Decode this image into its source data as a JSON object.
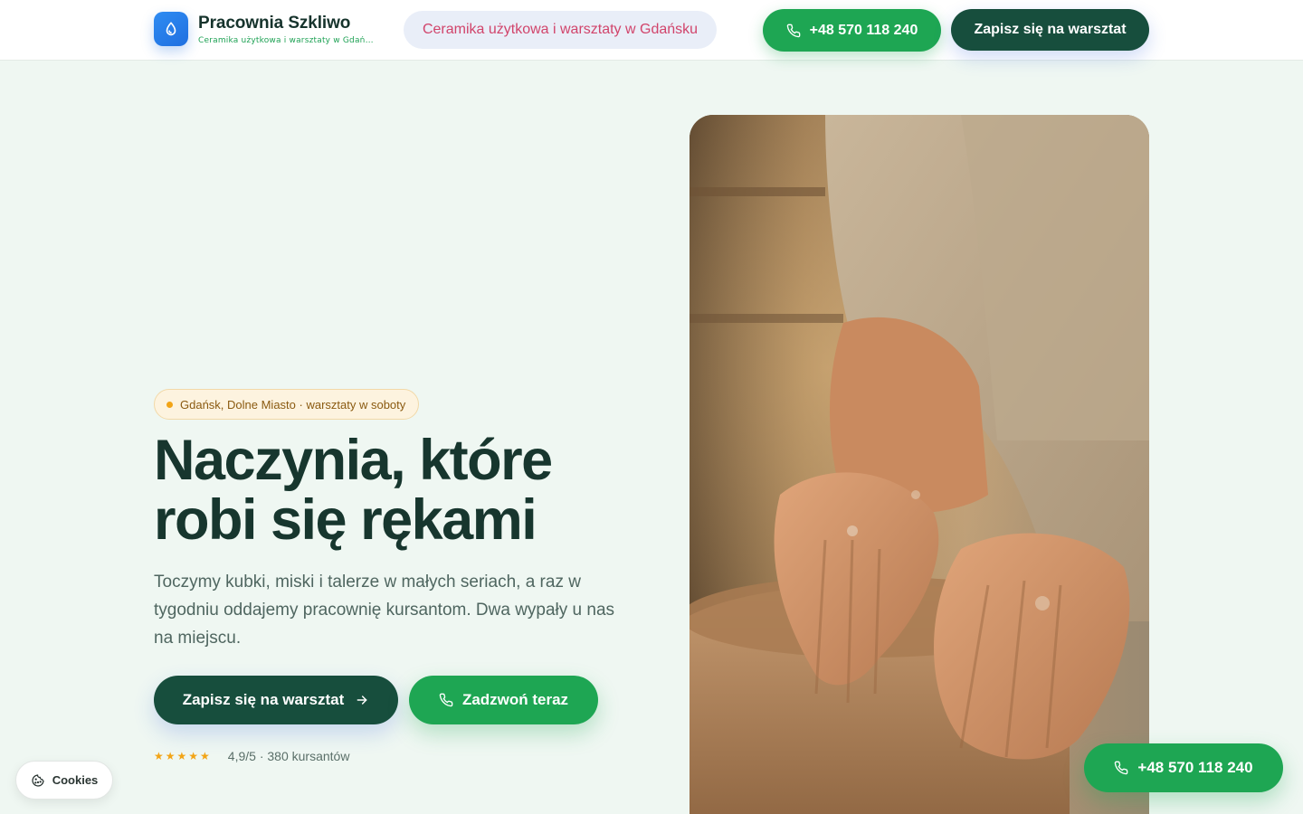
{
  "header": {
    "brand_name": "Pracownia Szkliwo",
    "brand_tagline": "Ceramika użytkowa i warsztaty w Gdańsku",
    "tagline_pill": "Ceramika użytkowa i warsztaty w Gdańsku",
    "phone_label": "+48 570 118 240",
    "signup_label": "Zapisz się na warsztat"
  },
  "hero": {
    "location_badge": "Gdańsk, Dolne Miasto · warsztaty w soboty",
    "title_line1": "Naczynia, które",
    "title_line2": "robi się rękami",
    "description": "Toczymy kubki, miski i talerze w małych seriach, a raz w tygodniu oddajemy pracownię kursantom. Dwa wypały u nas na miejscu.",
    "primary_cta": "Zapisz się na warsztat",
    "secondary_cta": "Zadzwoń teraz",
    "stars": "★★★★★",
    "rating_text": "4,9/5 · 380 kursantów"
  },
  "floating": {
    "cookies_label": "Cookies",
    "phone_label": "+48 570 118 240"
  },
  "icons": {
    "brand": "water-drop-icon",
    "phone": "phone-icon",
    "arrow": "arrow-right-icon",
    "cookie": "cookie-icon"
  },
  "colors": {
    "page_bg": "#eff7f2",
    "primary_dark": "#174e3d",
    "accent_green": "#1ea653",
    "brand_blue": "#1f6fe0",
    "pill_text": "#d1446b",
    "badge_dot": "#f2a416"
  }
}
